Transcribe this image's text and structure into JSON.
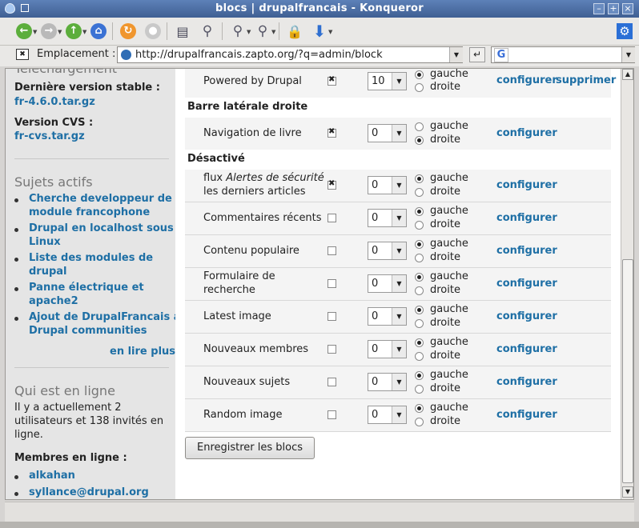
{
  "window": {
    "title": "blocs | drupalfrancais - Konqueror",
    "buttons": [
      "–",
      "+",
      "×"
    ]
  },
  "toolbar": {
    "icons": [
      "back-icon",
      "forward-icon",
      "up-icon",
      "home-icon",
      "reload-icon",
      "stop-icon",
      "clear-icon",
      "find-icon",
      "zoom-in-icon",
      "zoom-out-icon",
      "security-lock-icon",
      "download-icon",
      "konqueror-gear-icon"
    ]
  },
  "location": {
    "label": "Emplacement :",
    "url": "http://drupalfrancais.zapto.org/?q=admin/block",
    "search_engine": "G",
    "search_value": ""
  },
  "sidebar": {
    "partial_heading": "Téléchargement",
    "stable_label": "Dernière version stable :",
    "stable_link": "fr-4.6.0.tar.gz",
    "cvs_label": "Version CVS :",
    "cvs_link": "fr-cvs.tar.gz",
    "topics_heading": "Sujets actifs",
    "topics": [
      {
        "line1": "Cherche developpeur de",
        "line2": "module francophone"
      },
      {
        "line1": "Drupal en localhost sous",
        "line2": "Linux"
      },
      {
        "line1": "Liste des modules de",
        "line2": "drupal"
      },
      {
        "line1": "Panne électrique et",
        "line2": "apache2"
      },
      {
        "line1": "Ajout de DrupalFrancais a",
        "line2": "Drupal communities"
      }
    ],
    "read_more": "en lire plus",
    "online_heading": "Qui est en ligne",
    "online_text": [
      "Il y a actuellement 2",
      "utilisateurs et 138 invités en",
      "ligne."
    ],
    "members_label": "Membres en ligne :",
    "members": [
      "alkahan",
      "syllance@drupal.org"
    ]
  },
  "blocks": {
    "gauche": "gauche",
    "droite": "droite",
    "configure": "configurer",
    "delete": "supprimer",
    "regions": {
      "right": "Barre latérale droite",
      "disabled": "Désactivé"
    },
    "rows": [
      {
        "name": "Powered by Drupal",
        "enabled": true,
        "weight": "10",
        "side": "gauche",
        "delete": true
      },
      {
        "name": "Navigation de livre",
        "enabled": true,
        "weight": "0",
        "side": "droite",
        "delete": false
      },
      {
        "name_prefix": "flux ",
        "name_em": "Alertes de sécurité",
        "name_line2": "les derniers articles",
        "enabled": true,
        "weight": "0",
        "side": "gauche",
        "delete": false
      },
      {
        "name": "Commentaires récents",
        "enabled": false,
        "weight": "0",
        "side": "gauche",
        "delete": false
      },
      {
        "name": "Contenu populaire",
        "enabled": false,
        "weight": "0",
        "side": "gauche",
        "delete": false
      },
      {
        "name": "Formulaire de",
        "name_line2": "recherche",
        "enabled": false,
        "weight": "0",
        "side": "gauche",
        "delete": false
      },
      {
        "name": "Latest image",
        "enabled": false,
        "weight": "0",
        "side": "gauche",
        "delete": false
      },
      {
        "name": "Nouveaux membres",
        "enabled": false,
        "weight": "0",
        "side": "gauche",
        "delete": false
      },
      {
        "name": "Nouveaux sujets",
        "enabled": false,
        "weight": "0",
        "side": "gauche",
        "delete": false
      },
      {
        "name": "Random image",
        "enabled": false,
        "weight": "0",
        "side": "gauche",
        "delete": false
      }
    ],
    "submit": "Enregistrer les blocs"
  }
}
